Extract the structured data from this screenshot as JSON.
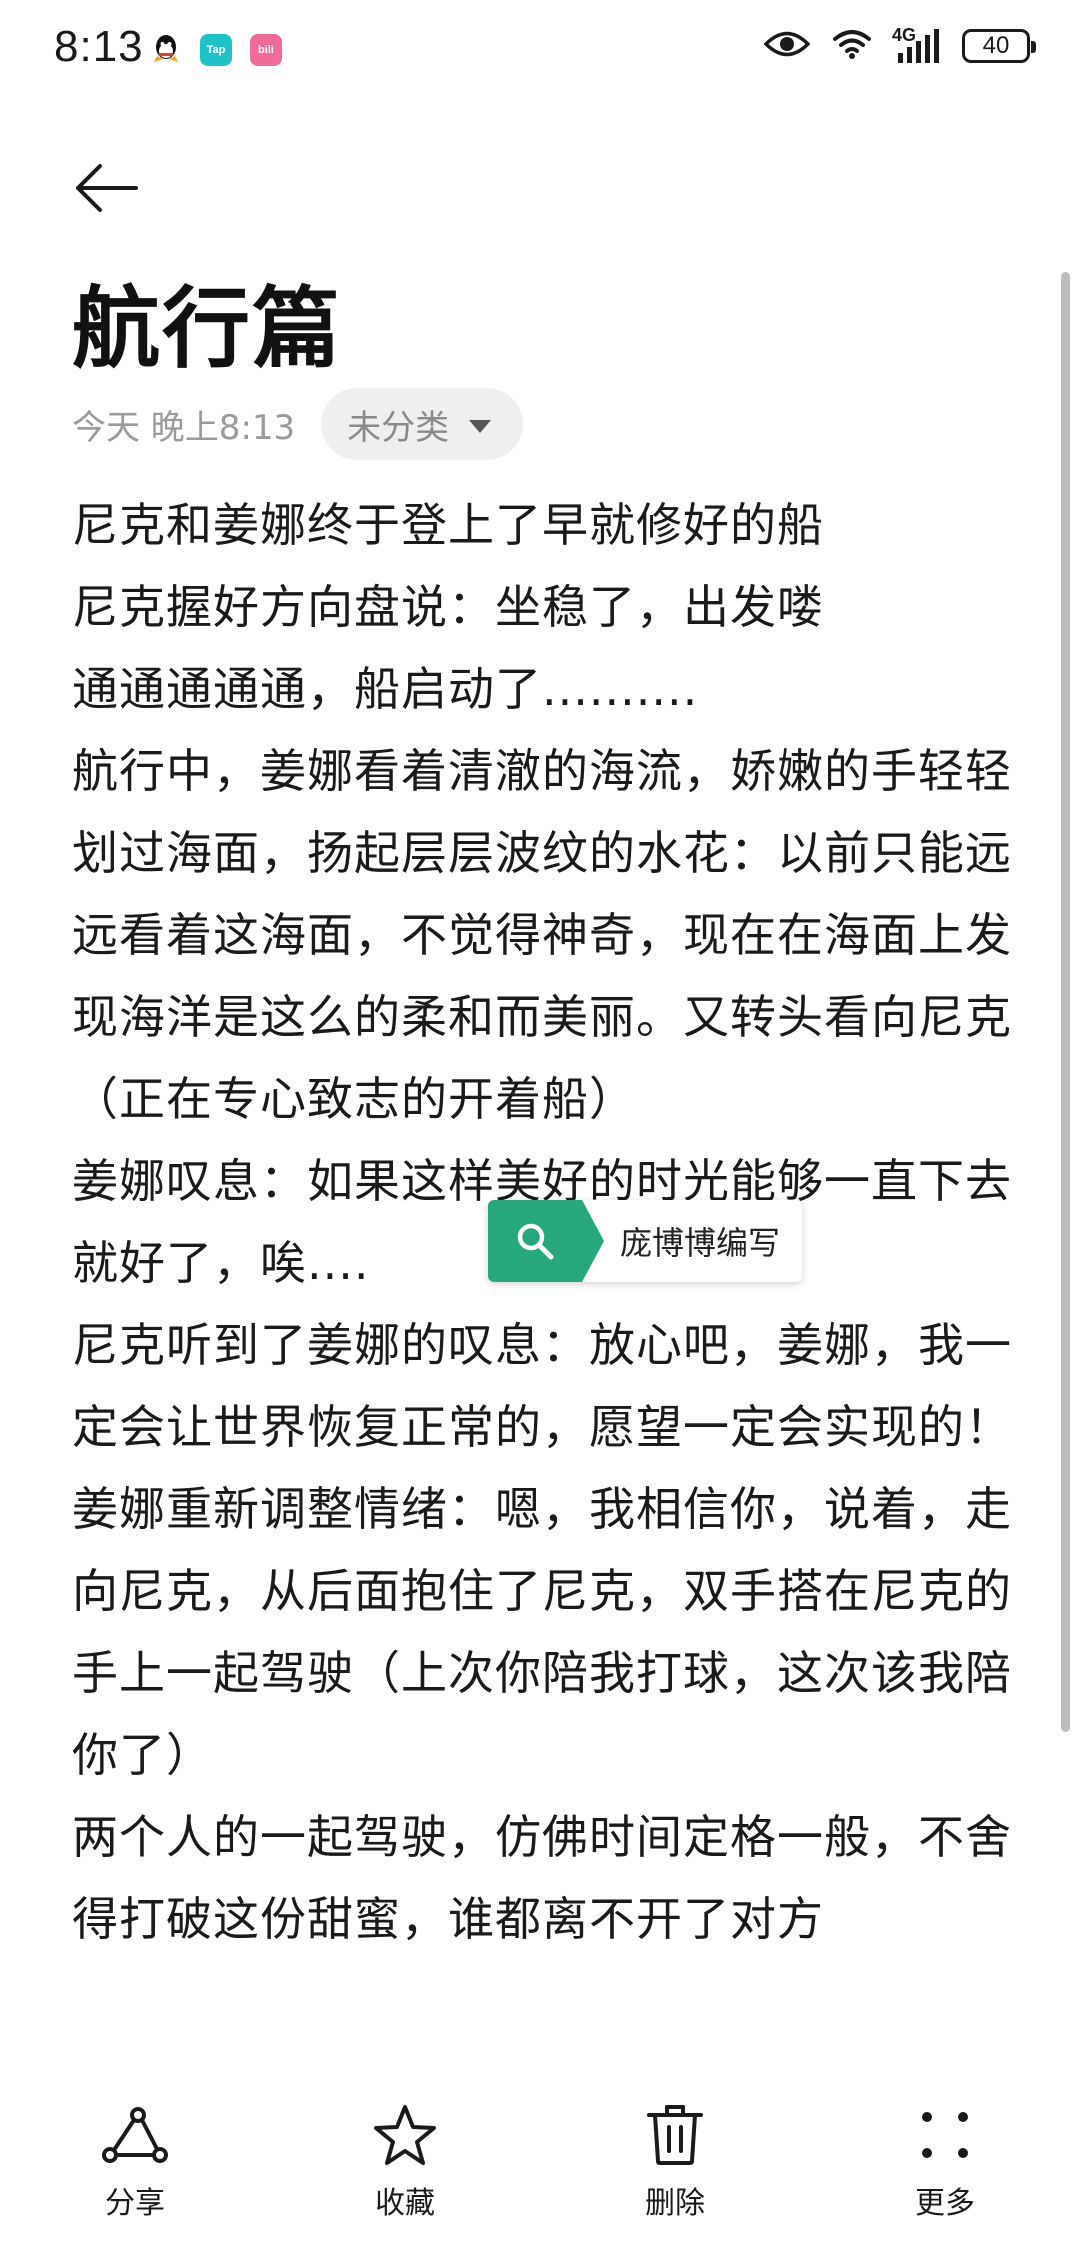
{
  "status_bar": {
    "time": "8:13",
    "network": "4G",
    "battery": "40",
    "app_icons": [
      "qq-icon",
      "taptap-icon",
      "bilibili-icon"
    ],
    "tap_label": "Tap",
    "bili_label": "bili"
  },
  "header": {
    "back_icon": "back-arrow-icon"
  },
  "note": {
    "title": "航行篇",
    "time": "今天 晚上8:13",
    "category": "未分类",
    "lines": [
      "尼克和姜娜终于登上了早就修好的船",
      "尼克握好方向盘说：坐稳了，出发喽",
      "通通通通通，船启动了..........",
      "航行中，姜娜看着清澈的海流，娇嫩的手轻轻划过海面，扬起层层波纹的水花：以前只能远远看着这海面，不觉得神奇，现在在海面上发现海洋是这么的柔和而美丽。又转头看向尼克（正在专心致志的开着船）",
      "姜娜叹息：如果这样美好的时光能够一直下去就好了，唉....",
      "尼克听到了姜娜的叹息：放心吧，姜娜，我一定会让世界恢复正常的，愿望一定会实现的！",
      "姜娜重新调整情绪：嗯，我相信你，说着，走向尼克，从后面抱住了尼克，双手搭在尼克的手上一起驾驶（上次你陪我打球，这次该我陪你了）",
      "两个人的一起驾驶，仿佛时间定格一般，不舍得打破这份甜蜜，谁都离不开了对方"
    ]
  },
  "search_tag": {
    "text": "庞博博编写",
    "icon": "search-icon",
    "color": "#27a87a"
  },
  "toolbar": {
    "share_label": "分享",
    "favorite_label": "收藏",
    "delete_label": "删除",
    "more_label": "更多"
  }
}
